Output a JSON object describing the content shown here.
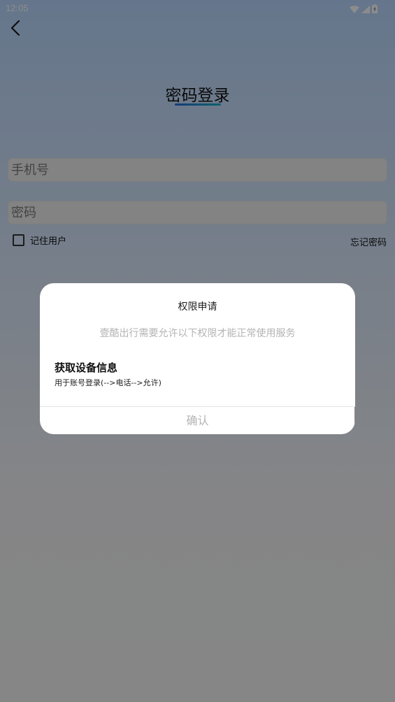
{
  "status_bar": {
    "time": "12:05",
    "icons": [
      "wifi-icon",
      "signal-icon",
      "battery-icon"
    ]
  },
  "page": {
    "title": "密码登录",
    "phone_placeholder": "手机号",
    "password_placeholder": "密码",
    "remember_label": "记住用户",
    "forgot_label": "忘记密码"
  },
  "dialog": {
    "title": "权限申请",
    "subtitle": "壹酷出行需要允许以下权限才能正常使用服务",
    "permission_title": "获取设备信息",
    "permission_desc": "用于账号登录(-->电话-->允许)",
    "confirm_label": "确认"
  },
  "colors": {
    "accent_gradient_start": "#2a6bd8",
    "accent_gradient_end": "#19b3c6",
    "dialog_bg": "#ffffff",
    "muted_text": "#b4b4b4"
  }
}
